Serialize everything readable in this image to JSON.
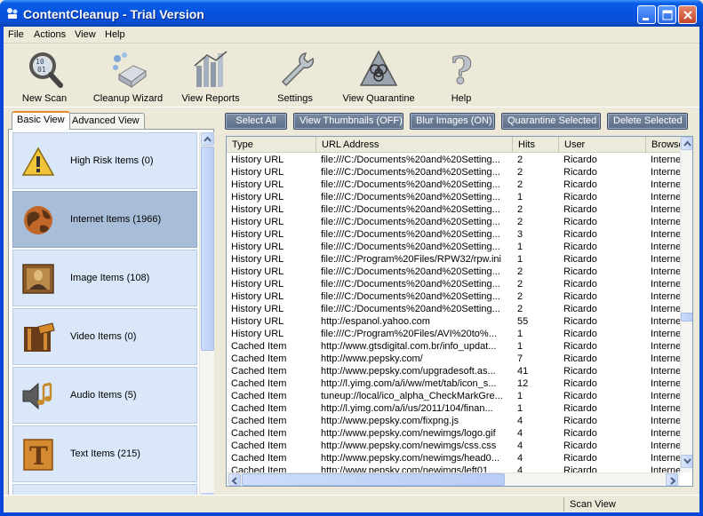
{
  "window": {
    "title": "ContentCleanup - Trial Version",
    "minimize_label": "Minimize",
    "maximize_label": "Maximize",
    "close_label": "Close"
  },
  "menu": [
    "File",
    "Actions",
    "View",
    "Help"
  ],
  "toolbar": [
    {
      "label": "New Scan",
      "icon": "new-scan-icon"
    },
    {
      "label": "Cleanup Wizard",
      "icon": "cleanup-wizard-icon"
    },
    {
      "label": "View Reports",
      "icon": "view-reports-icon"
    },
    {
      "label": "Settings",
      "icon": "settings-icon"
    },
    {
      "label": "View Quarantine",
      "icon": "view-quarantine-icon"
    },
    {
      "label": "Help",
      "icon": "help-icon"
    }
  ],
  "view_tabs": {
    "basic": "Basic View",
    "advanced": "Advanced View",
    "active": "Basic View"
  },
  "categories": [
    {
      "label": "High Risk Items (0)",
      "icon": "warning-icon",
      "selected": false
    },
    {
      "label": "Internet Items (1966)",
      "icon": "globe-icon",
      "selected": true
    },
    {
      "label": "Image Items (108)",
      "icon": "image-icon",
      "selected": false
    },
    {
      "label": "Video Items (0)",
      "icon": "video-icon",
      "selected": false
    },
    {
      "label": "Audio Items (5)",
      "icon": "audio-icon",
      "selected": false
    },
    {
      "label": "Text Items (215)",
      "icon": "text-icon",
      "selected": false
    }
  ],
  "actions": [
    "Select All",
    "View Thumbnails (OFF)",
    "Blur Images (ON)",
    "Quarantine Selected",
    "Delete Selected"
  ],
  "table": {
    "columns": [
      "Type",
      "URL Address",
      "Hits",
      "User",
      "Browser"
    ],
    "rows": [
      [
        "History URL",
        "file:///C:/Documents%20and%20Setting...",
        "2",
        "Ricardo",
        "Internet"
      ],
      [
        "History URL",
        "file:///C:/Documents%20and%20Setting...",
        "2",
        "Ricardo",
        "Internet"
      ],
      [
        "History URL",
        "file:///C:/Documents%20and%20Setting...",
        "2",
        "Ricardo",
        "Internet"
      ],
      [
        "History URL",
        "file:///C:/Documents%20and%20Setting...",
        "1",
        "Ricardo",
        "Internet"
      ],
      [
        "History URL",
        "file:///C:/Documents%20and%20Setting...",
        "2",
        "Ricardo",
        "Internet"
      ],
      [
        "History URL",
        "file:///C:/Documents%20and%20Setting...",
        "2",
        "Ricardo",
        "Internet"
      ],
      [
        "History URL",
        "file:///C:/Documents%20and%20Setting...",
        "3",
        "Ricardo",
        "Internet"
      ],
      [
        "History URL",
        "file:///C:/Documents%20and%20Setting...",
        "1",
        "Ricardo",
        "Internet"
      ],
      [
        "History URL",
        "file:///C:/Program%20Files/RPW32/rpw.ini",
        "1",
        "Ricardo",
        "Internet"
      ],
      [
        "History URL",
        "file:///C:/Documents%20and%20Setting...",
        "2",
        "Ricardo",
        "Internet"
      ],
      [
        "History URL",
        "file:///C:/Documents%20and%20Setting...",
        "2",
        "Ricardo",
        "Internet"
      ],
      [
        "History URL",
        "file:///C:/Documents%20and%20Setting...",
        "2",
        "Ricardo",
        "Internet"
      ],
      [
        "History URL",
        "file:///C:/Documents%20and%20Setting...",
        "2",
        "Ricardo",
        "Internet"
      ],
      [
        "History URL",
        "http://espanol.yahoo.com",
        "55",
        "Ricardo",
        "Internet"
      ],
      [
        "History URL",
        "file:///C:/Program%20Files/AVI%20to%...",
        "1",
        "Ricardo",
        "Internet"
      ],
      [
        "Cached Item",
        "http://www.gtsdigital.com.br/info_updat...",
        "1",
        "Ricardo",
        "Internet"
      ],
      [
        "Cached Item",
        "http://www.pepsky.com/",
        "7",
        "Ricardo",
        "Internet"
      ],
      [
        "Cached Item",
        "http://www.pepsky.com/upgradesoft.as...",
        "41",
        "Ricardo",
        "Internet"
      ],
      [
        "Cached Item",
        "http://l.yimg.com/a/i/ww/met/tab/icon_s...",
        "12",
        "Ricardo",
        "Internet"
      ],
      [
        "Cached Item",
        "tuneup://local/ico_alpha_CheckMarkGre...",
        "1",
        "Ricardo",
        "Internet"
      ],
      [
        "Cached Item",
        "http://l.yimg.com/a/i/us/2011/104/finan...",
        "1",
        "Ricardo",
        "Internet"
      ],
      [
        "Cached Item",
        "http://www.pepsky.com/fixpng.js",
        "4",
        "Ricardo",
        "Internet"
      ],
      [
        "Cached Item",
        "http://www.pepsky.com/newimgs/logo.gif",
        "4",
        "Ricardo",
        "Internet"
      ],
      [
        "Cached Item",
        "http://www.pepsky.com/newimgs/css.css",
        "4",
        "Ricardo",
        "Internet"
      ],
      [
        "Cached Item",
        "http://www.pepsky.com/newimgs/head0...",
        "4",
        "Ricardo",
        "Internet"
      ],
      [
        "Cached Item",
        "http://www.pepsky.com/newimgs/left01...",
        "4",
        "Ricardo",
        "Internet"
      ]
    ]
  },
  "status": {
    "left": "",
    "right": "Scan View"
  }
}
